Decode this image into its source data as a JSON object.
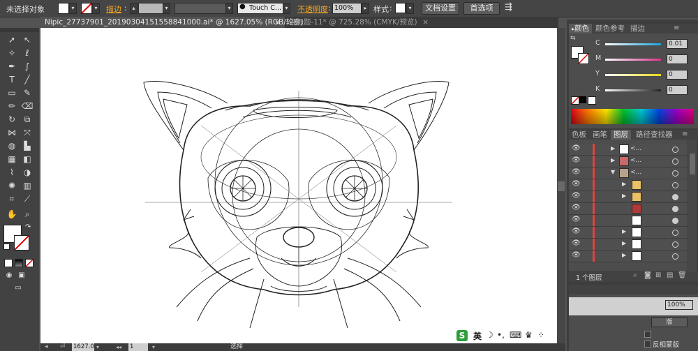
{
  "control_bar": {
    "selection_status": "未选择对象",
    "stroke_label": "描边",
    "touch_label": "Touch C...",
    "opacity_label": "不透明度",
    "opacity_value": "100%",
    "style_label": "样式",
    "doc_setup_button": "文档设置",
    "preferences_button": "首选项"
  },
  "document_tabs": [
    {
      "label": "Nipic_27737901_20190304151558841000.ai* @ 1627.05% (RGB/轮廓)",
      "close": "×",
      "active": true
    },
    {
      "label": "未标题-11* @ 725.28% (CMYK/预览)",
      "close": "×",
      "active": false
    }
  ],
  "color_panel": {
    "tabs": [
      "颜色",
      "颜色参考",
      "描边"
    ],
    "channels": [
      {
        "label": "C",
        "value": "0.01",
        "color": "#1aa3d9"
      },
      {
        "label": "M",
        "value": "0",
        "color": "#d9338c"
      },
      {
        "label": "Y",
        "value": "0",
        "color": "#e6d81a"
      },
      {
        "label": "K",
        "value": "0",
        "color": "#222222"
      }
    ]
  },
  "layers_panel": {
    "tabs": [
      "色板",
      "画笔",
      "图层",
      "路径查找器"
    ],
    "active_tab": "图层",
    "rows": [
      {
        "name": "<..."
      },
      {
        "name": "<..."
      },
      {
        "name": "<..."
      }
    ],
    "footer_count": "1 个图层"
  },
  "lower_panel": {
    "opacity_value": "100%",
    "version_label": "版",
    "reverse_label": "反相蒙版"
  },
  "status_bar": {
    "zoom": "1627.0",
    "page": "1",
    "tool_label": "选择"
  },
  "ime": {
    "lang": "英"
  },
  "colors": {
    "accent_orange": "#f5a623",
    "canvas_bg": "#ffffff",
    "ui_bg": "#535353"
  }
}
